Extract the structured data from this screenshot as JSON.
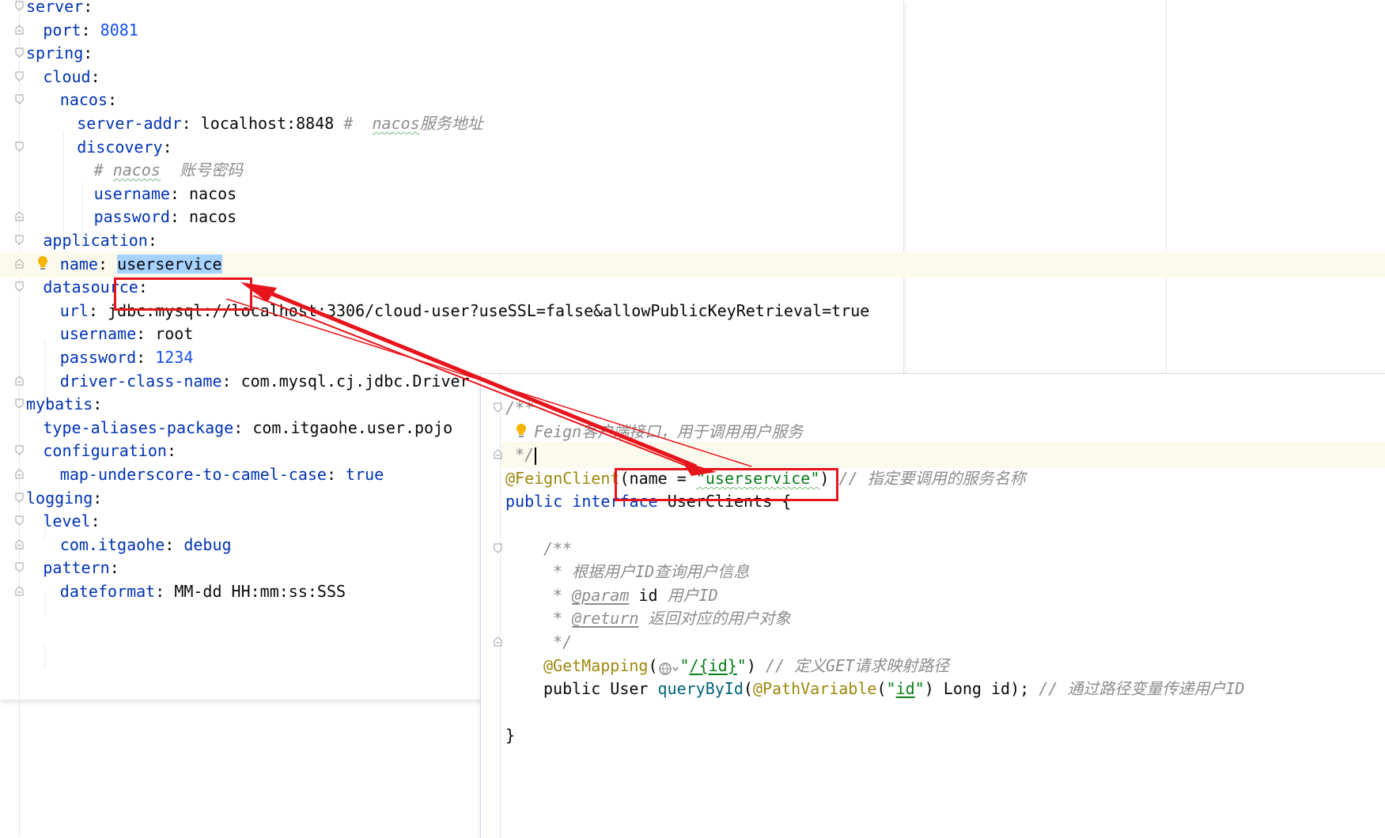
{
  "yaml": {
    "lines": [
      {
        "key": "server",
        "sep": ":",
        "val": "",
        "comment": ""
      },
      {
        "key": "port",
        "sep": ": ",
        "val": "8081",
        "comment": ""
      },
      {
        "key": "spring",
        "sep": ":",
        "val": "",
        "comment": ""
      },
      {
        "key": "cloud",
        "sep": ":",
        "val": "",
        "comment": ""
      },
      {
        "key": "nacos",
        "sep": ":",
        "val": "",
        "comment": ""
      },
      {
        "key": "server-addr",
        "sep": ": ",
        "val": "localhost:8848",
        "comment_hash": " #  ",
        "comment_word": "nacos",
        "comment_rest": "服务地址"
      },
      {
        "key": "discovery",
        "sep": ":",
        "val": "",
        "comment": ""
      },
      {
        "comment_hash": "# ",
        "comment_word": "nacos",
        "comment_rest": "  账号密码"
      },
      {
        "key": "username",
        "sep": ": ",
        "val": "nacos"
      },
      {
        "key": "password",
        "sep": ": ",
        "val": "nacos"
      },
      {
        "key": "application",
        "sep": ":",
        "val": ""
      },
      {
        "key": "name",
        "sep": ": ",
        "val": "userservice"
      },
      {
        "key": "datasource",
        "sep": ":",
        "val": ""
      },
      {
        "key": "url",
        "sep": ": ",
        "val": "jdbc:mysql://localhost:3306/cloud-user?useSSL=false&allowPublicKeyRetrieval=true"
      },
      {
        "key": "username",
        "sep": ": ",
        "val": "root"
      },
      {
        "key": "password",
        "sep": ": ",
        "val": "1234"
      },
      {
        "key": "driver-class-name",
        "sep": ": ",
        "val": "com.mysql.cj.jdbc.Driver"
      },
      {
        "key": "mybatis",
        "sep": ":",
        "val": ""
      },
      {
        "key": "type-aliases-package",
        "sep": ": ",
        "val": "com.itgaohe.user.pojo"
      },
      {
        "key": "configuration",
        "sep": ":",
        "val": ""
      },
      {
        "key": "map-underscore-to-camel-case",
        "sep": ": ",
        "val": "true"
      },
      {
        "key": "logging",
        "sep": ":",
        "val": ""
      },
      {
        "key": "level",
        "sep": ":",
        "val": ""
      },
      {
        "key": "com.itgaohe",
        "sep": ": ",
        "val": "debug"
      },
      {
        "key": "pattern",
        "sep": ":",
        "val": ""
      },
      {
        "key": "dateformat",
        "sep": ": ",
        "val": "MM-dd HH:mm:ss:SSS"
      }
    ]
  },
  "java": {
    "doc_open": "/**",
    "doc_feign_word": "Feign",
    "doc_feign_rest": "客户端接口，用于调用用户服务",
    "doc_close": " */",
    "annotation": "@FeignClient",
    "paren_open": "(name = ",
    "name_value": "\"userservice\"",
    "paren_close": ")",
    "annotation_comment": " // 指定要调用的服务名称",
    "kw_public": "public",
    "kw_interface": "interface",
    "class_name": "UserClients {",
    "m_doc_open": "/**",
    "m_doc_desc": " * 根据用户ID查询用户信息",
    "m_doc_param_tag": "@param",
    "m_doc_param_name": "id",
    "m_doc_param_desc": " 用户ID",
    "m_doc_return_tag": "@return",
    "m_doc_return_desc": " 返回对应的用户对象",
    "m_doc_close": " */",
    "get_mapping": "@GetMapping",
    "get_path_open": "\"",
    "get_path": "/{id}",
    "get_path_close": "\"",
    "get_comment": " // 定义GET请求映射路径",
    "m_public": "public",
    "m_type": "User",
    "m_name": "queryById",
    "path_variable": "@PathVariable",
    "pv_arg": "id",
    "m_params_rest": " Long id);",
    "m_comment": " // 通过路径变量传递用户ID",
    "brace_close": "}"
  },
  "colors": {
    "arrow": "#e8141b",
    "highlight_line": "#fcfaed",
    "selection": "#a6d2ff"
  }
}
